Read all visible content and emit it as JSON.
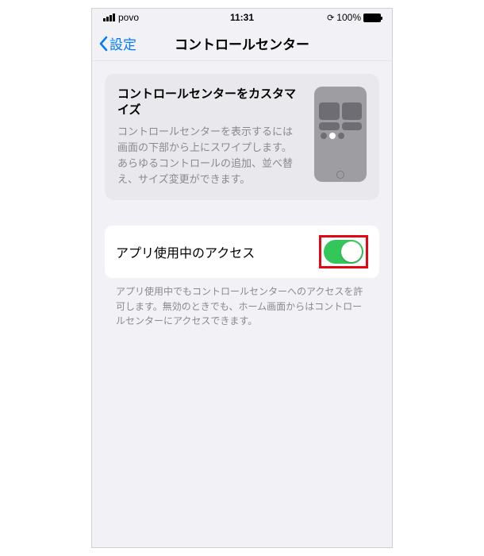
{
  "status_bar": {
    "carrier": "povo",
    "time": "11:31",
    "battery_percent": "100%",
    "orientation_lock_icon": "orientation-lock-icon"
  },
  "nav": {
    "back_label": "設定",
    "title": "コントロールセンター"
  },
  "info_card": {
    "title": "コントロールセンターをカスタマイズ",
    "description": "コントロールセンターを表示するには画面の下部から上にスワイプします。あらゆるコントロールの追加、並べ替え、サイズ変更ができます。"
  },
  "setting": {
    "label": "アプリ使用中のアクセス",
    "toggle_on": true,
    "footer": "アプリ使用中でもコントロールセンターへのアクセスを許可します。無効のときでも、ホーム画面からはコントロールセンターにアクセスできます。"
  },
  "colors": {
    "accent_blue": "#007aff",
    "switch_green": "#33c759",
    "highlight_red": "#e30613"
  }
}
